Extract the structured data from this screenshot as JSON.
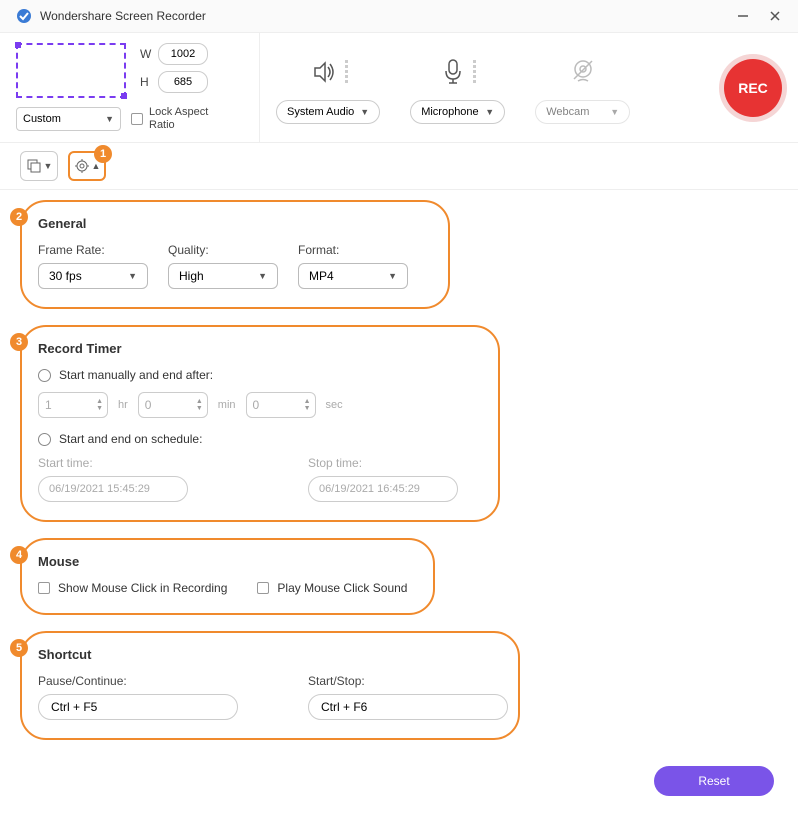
{
  "titlebar": {
    "title": "Wondershare Screen Recorder"
  },
  "capture": {
    "width": "1002",
    "height": "685",
    "w_label": "W",
    "h_label": "H",
    "preset": "Custom",
    "lock_label": "Lock Aspect Ratio"
  },
  "devices": {
    "audio_label": "System Audio",
    "mic_label": "Microphone",
    "webcam_label": "Webcam",
    "rec_label": "REC"
  },
  "callouts": {
    "n1": "1",
    "n2": "2",
    "n3": "3",
    "n4": "4",
    "n5": "5"
  },
  "general": {
    "title": "General",
    "frame_rate_label": "Frame Rate:",
    "frame_rate": "30 fps",
    "quality_label": "Quality:",
    "quality": "High",
    "format_label": "Format:",
    "format": "MP4"
  },
  "timer": {
    "title": "Record Timer",
    "opt1_label": "Start manually and end after:",
    "hr": "1",
    "hr_unit": "hr",
    "min": "0",
    "min_unit": "min",
    "sec": "0",
    "sec_unit": "sec",
    "opt2_label": "Start and end on schedule:",
    "start_label": "Start time:",
    "start_val": "06/19/2021 15:45:29",
    "stop_label": "Stop time:",
    "stop_val": "06/19/2021 16:45:29"
  },
  "mouse": {
    "title": "Mouse",
    "show_label": "Show Mouse Click in Recording",
    "sound_label": "Play Mouse Click Sound"
  },
  "shortcut": {
    "title": "Shortcut",
    "pause_label": "Pause/Continue:",
    "pause_val": "Ctrl + F5",
    "start_label": "Start/Stop:",
    "start_val": "Ctrl + F6"
  },
  "footer": {
    "reset": "Reset"
  }
}
